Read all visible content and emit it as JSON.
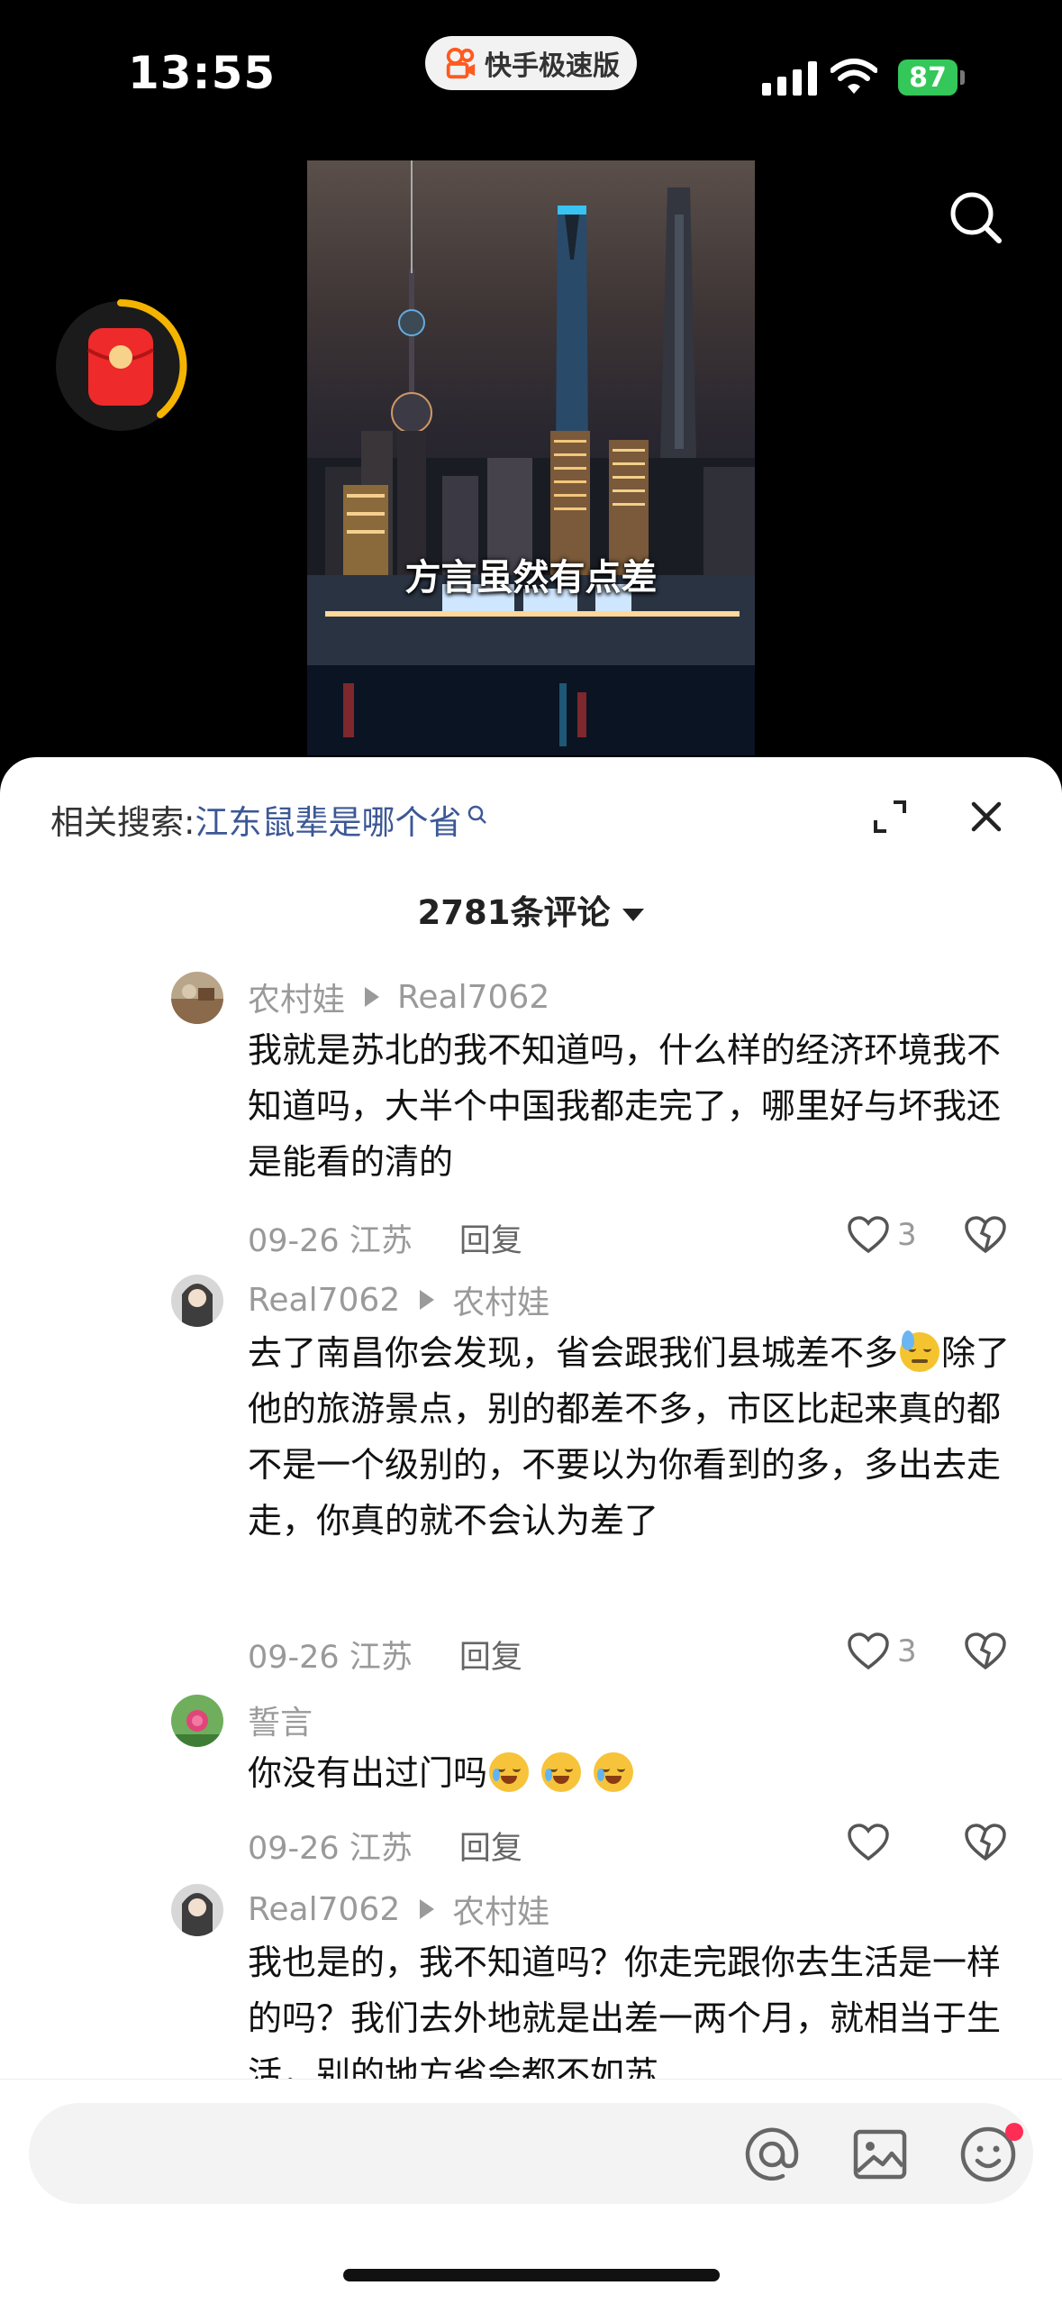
{
  "status_bar": {
    "time": "13:55",
    "app_name": "快手极速版",
    "battery": "87",
    "icons": [
      "signal-icon",
      "wifi-icon",
      "battery-icon"
    ]
  },
  "video": {
    "caption": "方言虽然有点差"
  },
  "sheet": {
    "related_label": "相关搜索:",
    "related_query": "江东鼠辈是哪个省",
    "comment_count": "2781条评论"
  },
  "comments": [
    {
      "author": "农村娃",
      "reply_to": "Real7062",
      "text": "我就是苏北的我不知道吗，什么样的经济环境我不知道吗，大半个中国我都走完了，哪里好与坏我还是能看的清的",
      "date_location": "09-26 江苏",
      "reply_label": "回复",
      "likes": "3"
    },
    {
      "author": "Real7062",
      "reply_to": "农村娃",
      "text_before_emoji": "去了南昌你会发现，省会跟我们县城差不多",
      "text_after_emoji": "除了他的旅游景点，别的都差不多，市区比起来真的都不是一个级别的，不要以为你看到的多，多出去走走，你真的就不会认为差了",
      "date_location": "09-26 江苏",
      "reply_label": "回复",
      "likes": "3"
    },
    {
      "author": "誓言",
      "text": "你没有出过门吗",
      "date_location": "09-26 江苏",
      "reply_label": "回复",
      "likes": ""
    },
    {
      "author": "Real7062",
      "reply_to": "农村娃",
      "text": "我也是的，我不知道吗？你走完跟你去生活是一样的吗？我们去外地就是出差一两个月，就相当于生活，别的地方省会都不如苏"
    }
  ],
  "input_bar": {
    "placeholder": "",
    "icons": [
      "at-icon",
      "image-icon",
      "emoji-icon"
    ]
  },
  "colors": {
    "link": "#3c5896",
    "battery": "#34c759",
    "notification_dot": "#ff2d55",
    "redpacket": "#ee2a2a"
  }
}
